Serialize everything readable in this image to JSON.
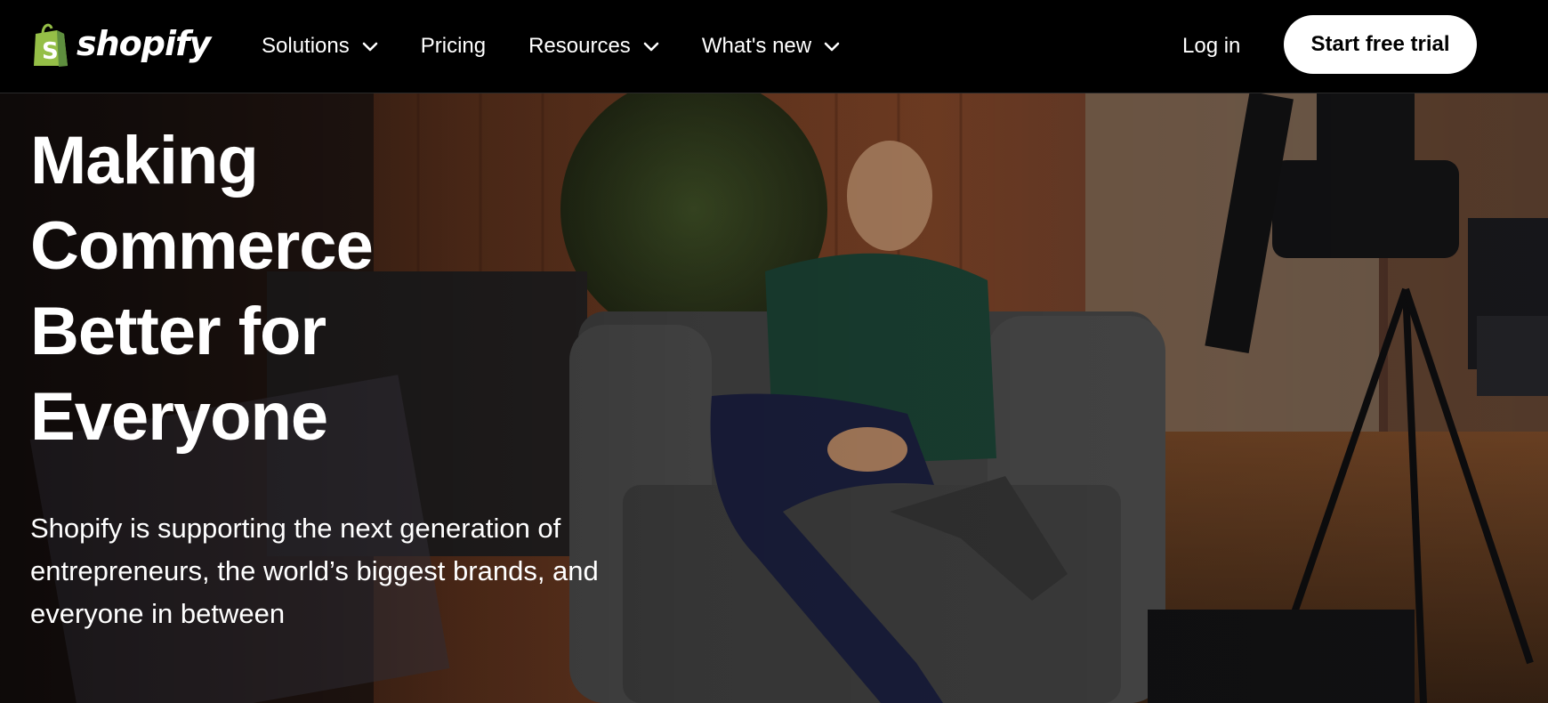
{
  "nav": {
    "logo_text": "shopify",
    "items": [
      {
        "label": "Solutions",
        "has_dropdown": true
      },
      {
        "label": "Pricing",
        "has_dropdown": false
      },
      {
        "label": "Resources",
        "has_dropdown": true
      },
      {
        "label": "What's new",
        "has_dropdown": true
      }
    ],
    "login_label": "Log in",
    "cta_label": "Start free trial"
  },
  "hero": {
    "headline_lines": [
      "Making",
      "Commerce",
      "Better for",
      "Everyone"
    ],
    "subhead": "Shopify is supporting the next generation of entrepreneurs, the world’s biggest brands, and everyone in between"
  },
  "colors": {
    "nav_bg": "#000000",
    "logo_bag": "#95bf47",
    "logo_bag_dark": "#5e8e3e",
    "cta_bg": "#ffffff",
    "cta_text": "#000000",
    "text": "#ffffff"
  }
}
